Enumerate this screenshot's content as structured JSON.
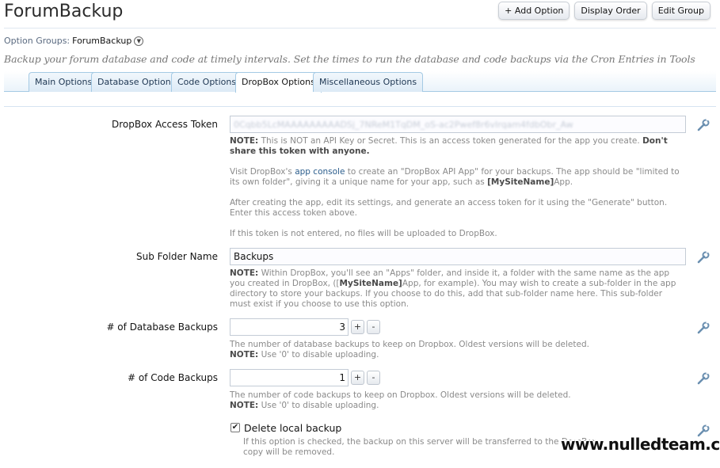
{
  "page": {
    "title": "ForumBackup",
    "buttons": {
      "add_option": "+ Add Option",
      "display_order": "Display Order",
      "edit_group": "Edit Group"
    },
    "option_groups_label": "Option Groups:",
    "option_groups_value": "ForumBackup",
    "description": "Backup your forum database and code at timely intervals. Set the times to run the database and code backups via the Cron Entries in Tools"
  },
  "tabs": [
    "Main Options",
    "Database Options",
    "Code Options",
    "DropBox Options",
    "Miscellaneous Options"
  ],
  "active_tab": "DropBox Options",
  "fields": {
    "token": {
      "label": "DropBox Access Token",
      "value": "0Cqbb5LcMAAAAAAAAADSj_7NReM1TqDM_oS-ac2Pwef8r6vIrqam4fdbObr_Aw",
      "note_label": "NOTE:",
      "note_text": "This is NOT an API Key or Secret. This is an access token generated for the app you create.",
      "note_bold": "Don't share this token with anyone.",
      "p2_a": "Visit DropBox's",
      "p2_link": "app console",
      "p2_b": "to create an \"DropBox API App\" for your backups. The app should be \"limited to its own folder\", giving it a unique name for your app, such as",
      "p2_bold": "[MySiteName]",
      "p2_c": "App.",
      "p3": "After creating the app, edit its settings, and generate an access token for it using the \"Generate\" button. Enter this access token above.",
      "p4": "If this token is not entered, no files will be uploaded to DropBox."
    },
    "subfolder": {
      "label": "Sub Folder Name",
      "value": "Backups",
      "note_label": "NOTE:",
      "note_a": "Within DropBox, you'll see an \"Apps\" folder, and inside it, a folder with the same name as the app you created in DropBox, ([",
      "note_bold": "MySiteName]",
      "note_b": "App, for example). You may wish to create a sub-folder in the app directory to store your backups. If you choose to do this, add that sub-folder name here. This sub-folder must exist if you choose to use this option."
    },
    "db_backups": {
      "label": "# of Database Backups",
      "value": "3",
      "plus": "+",
      "minus": "-",
      "hint": "The number of database backups to keep on Dropbox. Oldest versions will be deleted.",
      "note_label": "NOTE:",
      "note": "Use '0' to disable uploading."
    },
    "code_backups": {
      "label": "# of Code Backups",
      "value": "1",
      "plus": "+",
      "minus": "-",
      "hint": "The number of code backups to keep on Dropbox. Oldest versions will be deleted.",
      "note_label": "NOTE:",
      "note": "Use '0' to disable uploading."
    },
    "delete_local": {
      "label": "Delete local backup",
      "checked": true,
      "checkmark": "✔",
      "hint": "If this option is checked, the backup on this server will be transferred to the DropBox",
      "hint2": "copy will be removed."
    }
  },
  "watermark": "www.nulledteam.com"
}
